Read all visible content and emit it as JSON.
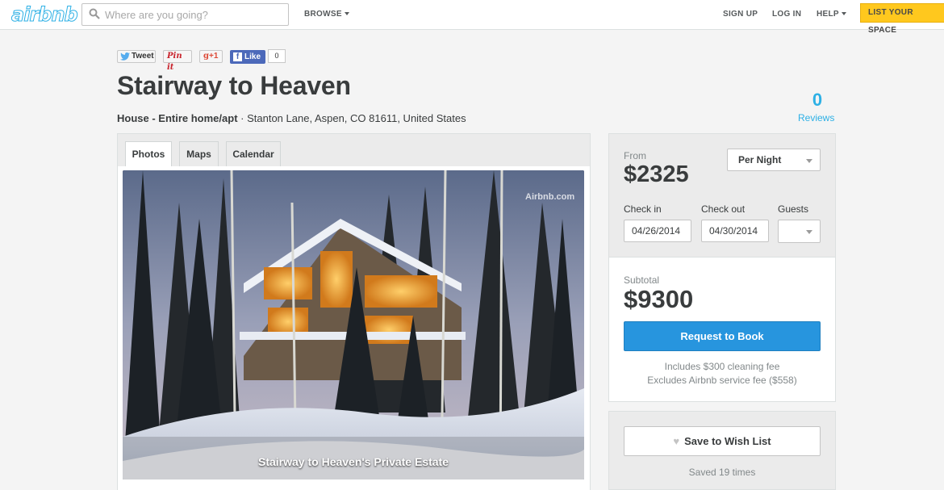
{
  "header": {
    "logo": "airbnb",
    "search_placeholder": "Where are you going?",
    "browse": "BROWSE",
    "sign_up": "SIGN UP",
    "log_in": "LOG IN",
    "help": "HELP",
    "list_space": "LIST YOUR SPACE"
  },
  "social": {
    "tweet": "Tweet",
    "pinit": "Pin it",
    "gplus": "+1",
    "fb_like": "Like",
    "fb_count": "0"
  },
  "listing": {
    "title": "Stairway to Heaven",
    "type": "House - Entire home/apt",
    "separator": " · ",
    "address": "Stanton Lane, Aspen, CO 81611, United States",
    "reviews_count": "0",
    "reviews_label": "Reviews"
  },
  "tabs": [
    "Photos",
    "Maps",
    "Calendar"
  ],
  "photo": {
    "caption": "Stairway to Heaven's Private Estate",
    "watermark": "Airbnb.com"
  },
  "booking": {
    "from_label": "From",
    "price": "$2325",
    "period": "Per Night",
    "check_in_label": "Check in",
    "check_out_label": "Check out",
    "guests_label": "Guests",
    "check_in": "04/26/2014",
    "check_out": "04/30/2014",
    "subtotal_label": "Subtotal",
    "subtotal": "$9300",
    "request_button": "Request to Book",
    "cleaning_fee": "Includes $300 cleaning fee",
    "service_fee": "Excludes Airbnb service fee ($558)"
  },
  "wishlist": {
    "button": "Save to Wish List",
    "saved": "Saved 19 times"
  },
  "colors": {
    "brand": "#2db0e5",
    "list_space_bg": "#ffc81e",
    "request_button": "#2795de"
  }
}
